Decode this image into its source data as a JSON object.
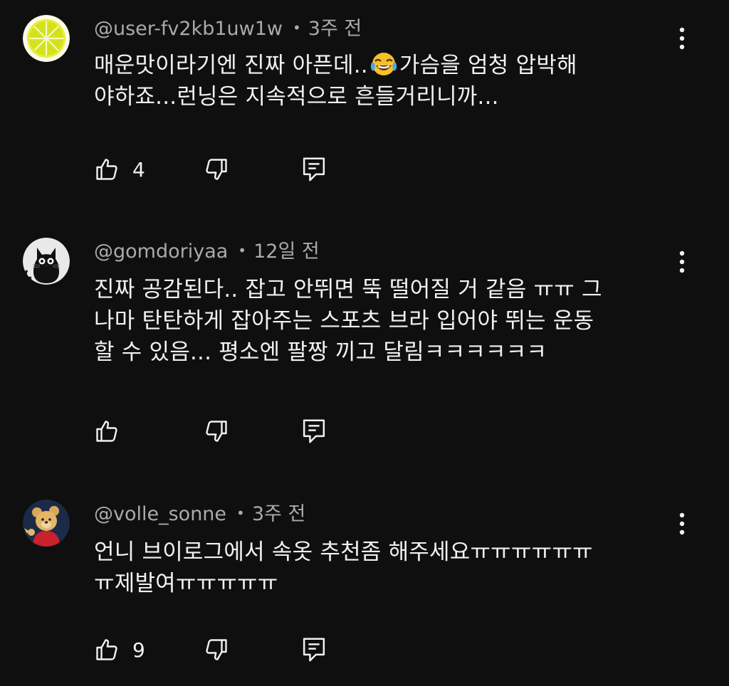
{
  "comments": [
    {
      "author": "@user-fv2kb1uw1w",
      "time": "3주 전",
      "lines": [
        "매운맛이라기엔 진짜 아픈데..",
        "가슴을 엄청 압박해",
        "야하죠...런닝은 지속적으로 흔들거리니까..."
      ],
      "likes": "4",
      "avatar_icon": "lemon-slice-avatar",
      "emoji": "face-with-tears-of-joy"
    },
    {
      "author": "@gomdoriyaa",
      "time": "12일 전",
      "lines": [
        "진짜 공감된다.. 잡고 안뛰면 뚝 떨어질 거 같음 ㅠㅠ 그",
        "나마 탄탄하게 잡아주는 스포츠 브라 입어야 뛰는 운동",
        "할 수 있음... 평소엔 팔짱 끼고 달림ㅋㅋㅋㅋㅋㅋ"
      ],
      "likes": "",
      "avatar_icon": "black-cat-avatar"
    },
    {
      "author": "@volle_sonne",
      "time": "3주 전",
      "lines": [
        "언니 브이로그에서 속옷 추천좀 해주세요ㅠㅠㅠㅠㅠㅠ",
        "ㅠ제발여ㅠㅠㅠㅠㅠ"
      ],
      "likes": "9",
      "avatar_icon": "bear-character-avatar"
    }
  ],
  "colors": {
    "background": "#0f0f0f",
    "primary_text": "#f1f1f1",
    "secondary_text": "#aaaaaa"
  },
  "icons": {
    "more": "more-vertical-icon",
    "like": "thumb-up-icon",
    "dislike": "thumb-down-icon",
    "reply": "reply-comment-icon"
  }
}
